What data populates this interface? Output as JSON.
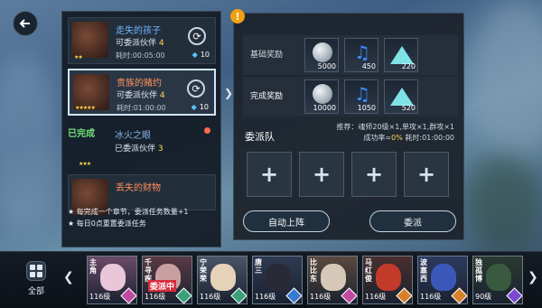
{
  "missions": [
    {
      "title": "走失的孩子",
      "partner_label": "可委派伙伴",
      "partner_count": "4",
      "time": "耗时:00:05:00",
      "cost": "10",
      "stars": "★★",
      "state": "normal"
    },
    {
      "title": "贵族的赌约",
      "partner_label": "可委派伙伴",
      "partner_count": "4",
      "time": "耗时:01:00:00",
      "cost": "10",
      "stars": "★★★★★",
      "state": "selected"
    },
    {
      "title": "冰火之眼",
      "partner_label": "已委派伙伴",
      "partner_count": "3",
      "status": "已完成",
      "stars": "★★★",
      "state": "done"
    },
    {
      "title": "丢失的财物",
      "stars": "★★",
      "state": "partial"
    }
  ],
  "notes": [
    "★ 每完成一个章节，委派任务数量+1",
    "★ 每日0点重置委派任务"
  ],
  "rewards": {
    "basic_label": "基础奖励",
    "complete_label": "完成奖励",
    "basic": [
      {
        "icon": "silver-coin-icon",
        "qty": "5000"
      },
      {
        "icon": "music-note-icon",
        "qty": "450"
      },
      {
        "icon": "crystal-icon",
        "qty": "220"
      }
    ],
    "complete": [
      {
        "icon": "silver-coin-icon",
        "qty": "10000"
      },
      {
        "icon": "music-note-icon",
        "qty": "1050"
      },
      {
        "icon": "crystal-icon",
        "qty": "520"
      }
    ]
  },
  "team": {
    "label": "委派队",
    "recommend": "推荐：魂师20级×1,单攻×1,群攻×1",
    "success_label": "成功率=",
    "success_value": "0%",
    "duration": "耗时:01:00:00",
    "slot_symbol": "+"
  },
  "buttons": {
    "auto": "自动上阵",
    "dispatch": "委派"
  },
  "roster": {
    "all_label": "全部",
    "left_arrow": "❮",
    "right_arrow": "❯",
    "heroes": [
      {
        "name": "主角",
        "level": "116级",
        "cls_color": "#c04aa0",
        "face": "#e9c6d8",
        "bg": "#6b4a6a"
      },
      {
        "name": "千寻疾",
        "level": "116级",
        "cls_color": "#3aa07a",
        "face": "#c9a0a0",
        "bg": "#5a3a44",
        "assigned": "委派中"
      },
      {
        "name": "宁荣荣",
        "level": "116级",
        "cls_color": "#3aa07a",
        "face": "#e6d2b8",
        "bg": "#4a5468"
      },
      {
        "name": "唐三",
        "level": "116级",
        "cls_color": "#3a7ad0",
        "face": "#2a2a36",
        "bg": "#2e3a52"
      },
      {
        "name": "比比东",
        "level": "116级",
        "cls_color": "#c04aa0",
        "face": "#d6c8b8",
        "bg": "#5a4a3e"
      },
      {
        "name": "马红俊",
        "level": "116级",
        "cls_color": "#d6802a",
        "face": "#c23a2a",
        "bg": "#4a2e2e"
      },
      {
        "name": "波塞西",
        "level": "116级",
        "cls_color": "#d6802a",
        "face": "#3a58b8",
        "bg": "#2e3a5e"
      },
      {
        "name": "独孤博",
        "level": "90级",
        "cls_color": "#7a4ad0",
        "face": "#3a5a40",
        "bg": "#2a3a30"
      }
    ]
  },
  "colors": {
    "accent": "#6fb7ff",
    "orange": "#ff8f5a",
    "gold": "#ffd54a",
    "done_green": "#72e07a",
    "warn": "#f2a012"
  }
}
